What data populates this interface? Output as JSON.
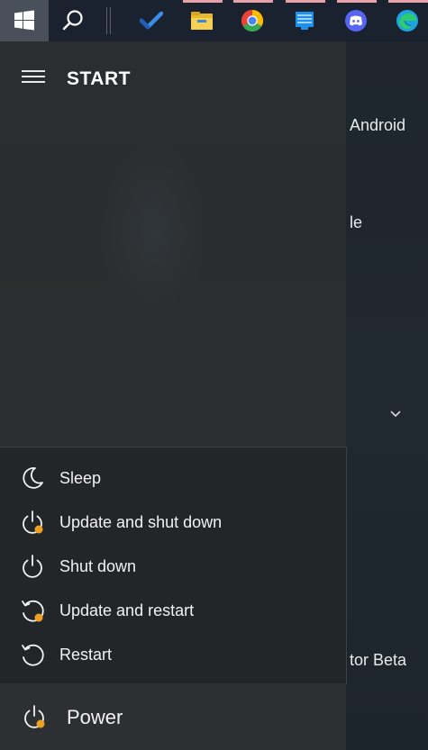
{
  "taskbar": {
    "start_icon": "windows-logo-icon",
    "search_icon": "search-icon",
    "apps": [
      {
        "name": "todo-check-icon",
        "color": "#2f7ad9"
      },
      {
        "name": "file-explorer-icon",
        "color": "#f4c445"
      },
      {
        "name": "chrome-icon",
        "color": "#e94335"
      },
      {
        "name": "app-window-icon",
        "color": "#1e90e8"
      },
      {
        "name": "discord-icon",
        "color": "#5865f2"
      },
      {
        "name": "edge-icon",
        "color": "#1fa3e0"
      }
    ]
  },
  "start": {
    "menu_icon": "hamburger-menu-icon",
    "title": "START"
  },
  "background": {
    "text1": "Android",
    "text2": "le",
    "text3": "tor Beta",
    "chevron": "chevron-down-icon"
  },
  "power_menu": {
    "items": [
      {
        "label": "Sleep",
        "icon": "sleep-moon-icon"
      },
      {
        "label": "Update and shut down",
        "icon": "update-shutdown-icon"
      },
      {
        "label": "Shut down",
        "icon": "shutdown-icon"
      },
      {
        "label": "Update and restart",
        "icon": "update-restart-icon"
      },
      {
        "label": "Restart",
        "icon": "restart-icon"
      }
    ]
  },
  "power": {
    "label": "Power",
    "icon": "power-icon"
  },
  "colors": {
    "update_dot": "#f0a020",
    "taskbar": "#1a2230",
    "menu_bg": "#232629"
  }
}
